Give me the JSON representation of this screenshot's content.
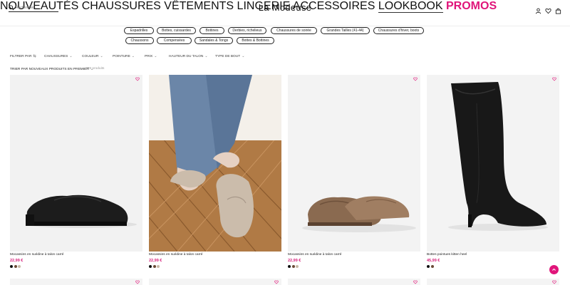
{
  "brand": "La Modeuse",
  "search": {
    "placeholder": "Rechercher"
  },
  "header_icons": [
    "user-icon",
    "heart-icon",
    "bag-icon"
  ],
  "nav": [
    {
      "label": "NOUVEAUTÉS",
      "promo": false
    },
    {
      "label": "CHAUSSURES",
      "promo": false
    },
    {
      "label": "VÊTEMENTS",
      "promo": false
    },
    {
      "label": "LINGERIE",
      "promo": false
    },
    {
      "label": "ACCESSOIRES",
      "promo": false
    },
    {
      "label": "LOOKBOOK",
      "promo": false
    },
    {
      "label": "PROMOS",
      "promo": true
    }
  ],
  "categories_row1": [
    "Espadrilles",
    "Bottes, cuissardes",
    "Bottines",
    "Derbies, richelieus",
    "Chaussures de soirée",
    "Grandes Tailles (41-44)",
    "Chaussures d'hiver, boots"
  ],
  "categories_row2": [
    "Chaussons",
    "Compensées",
    "Sandales & Tongs",
    "Bottes & Bottines"
  ],
  "filters": {
    "filter_by": "FILTRER PAR",
    "items": [
      "CHAUSSURES",
      "COULEUR",
      "POINTURE",
      "PRIX",
      "HAUTEUR DU TALON",
      "TYPE DE BOUT"
    ]
  },
  "sort": {
    "label": "TRIER PAR NOUVEAUX PRODUITS EN PREMIER"
  },
  "product_count": "399 produits",
  "products": [
    {
      "name": "Mocassins en suédine à talon carré",
      "price": "22,99 €",
      "swatches": [
        "#111111",
        "#6b4a36",
        "#c8b8a6"
      ]
    },
    {
      "name": "Mocassins en suédine à talon carré",
      "price": "22,99 €",
      "swatches": [
        "#111111",
        "#6b4a36",
        "#c8b8a6"
      ]
    },
    {
      "name": "Mocassins en suédine à talon carré",
      "price": "22,99 €",
      "swatches": [
        "#111111",
        "#6b4a36",
        "#c8b8a6"
      ]
    },
    {
      "name": "Bottes pointues kitten heel",
      "price": "45,99 €",
      "swatches": [
        "#111111",
        "#6b4a36"
      ]
    }
  ],
  "colors": {
    "accent": "#e0157a",
    "price": "#d61f7a"
  }
}
